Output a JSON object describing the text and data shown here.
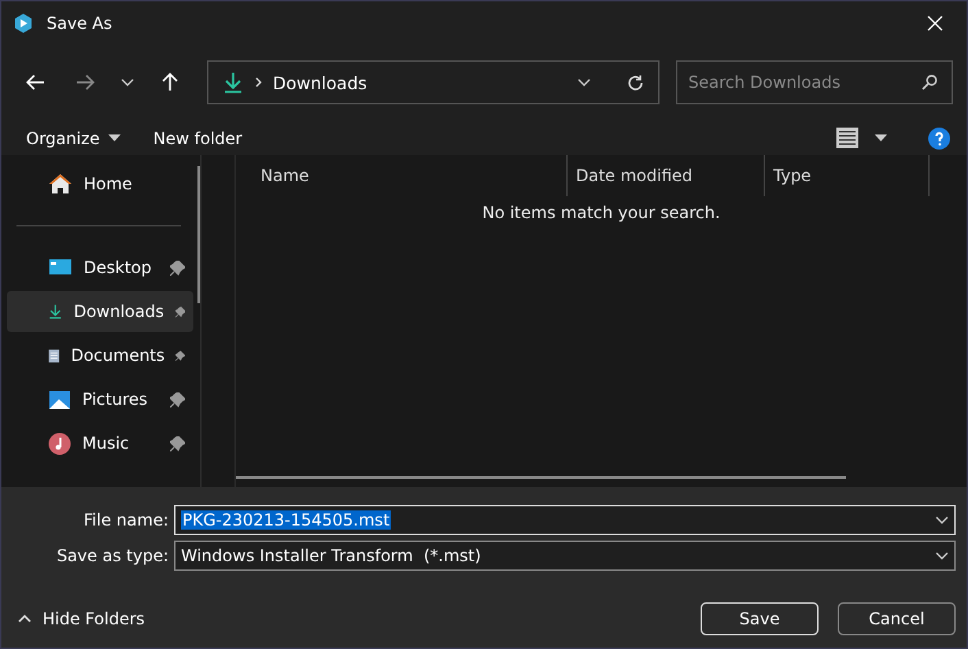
{
  "window": {
    "title": "Save As"
  },
  "address_bar": {
    "location": "Downloads"
  },
  "search": {
    "placeholder": "Search Downloads"
  },
  "toolbar": {
    "organize": "Organize",
    "new_folder": "New folder"
  },
  "sidebar": {
    "items": [
      {
        "label": "Home",
        "kind": "home",
        "selected": false
      },
      {
        "label": "Desktop",
        "kind": "desktop",
        "selected": false
      },
      {
        "label": "Downloads",
        "kind": "downloads",
        "selected": true
      },
      {
        "label": "Documents",
        "kind": "documents",
        "selected": false
      },
      {
        "label": "Pictures",
        "kind": "pictures",
        "selected": false
      },
      {
        "label": "Music",
        "kind": "music",
        "selected": false
      }
    ]
  },
  "table": {
    "columns": [
      "Name",
      "Date modified",
      "Type"
    ],
    "empty_message": "No items match your search."
  },
  "file_name": {
    "label": "File name:",
    "value": "PKG-230213-154505.mst"
  },
  "save_as_type": {
    "label": "Save as type:",
    "value": "Windows Installer Transform  (*.mst)"
  },
  "hide_folders": "Hide Folders",
  "buttons": [
    "Save",
    "Cancel"
  ]
}
